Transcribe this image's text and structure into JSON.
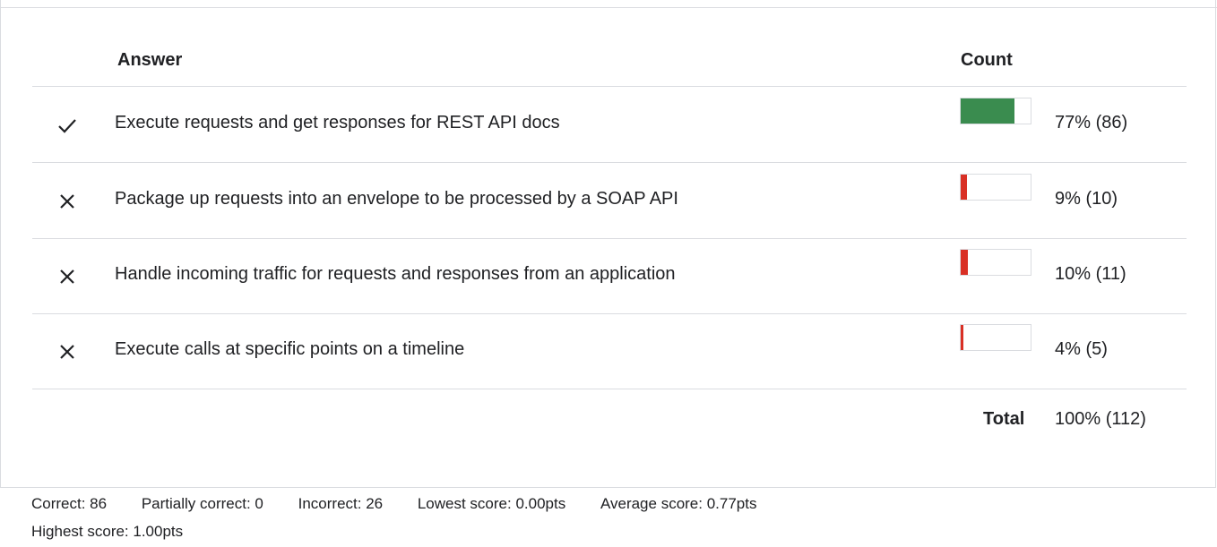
{
  "header": {
    "answer_label": "Answer",
    "count_label": "Count"
  },
  "rows": [
    {
      "status": "correct",
      "icon": "check-icon",
      "text": "Execute requests and get responses for REST API docs",
      "percent": 77,
      "count_text": "77% (86)",
      "bar_color": "#3a8c4f"
    },
    {
      "status": "incorrect",
      "icon": "close-icon",
      "text": "Package up requests into an envelope to be processed by a SOAP API",
      "percent": 9,
      "count_text": "9% (10)",
      "bar_color": "#d93025"
    },
    {
      "status": "incorrect",
      "icon": "close-icon",
      "text": "Handle incoming traffic for requests and responses from an application",
      "percent": 10,
      "count_text": "10% (11)",
      "bar_color": "#d93025"
    },
    {
      "status": "incorrect",
      "icon": "close-icon",
      "text": "Execute calls at specific points on a timeline",
      "percent": 4,
      "count_text": "4% (5)",
      "bar_color": "#d93025"
    }
  ],
  "total": {
    "label": "Total",
    "value": "100% (112)"
  },
  "stats": {
    "correct": "Correct: 86",
    "partially_correct": "Partially correct: 0",
    "incorrect": "Incorrect: 26",
    "lowest": "Lowest score: 0.00pts",
    "average": "Average score: 0.77pts",
    "highest": "Highest score: 1.00pts"
  }
}
